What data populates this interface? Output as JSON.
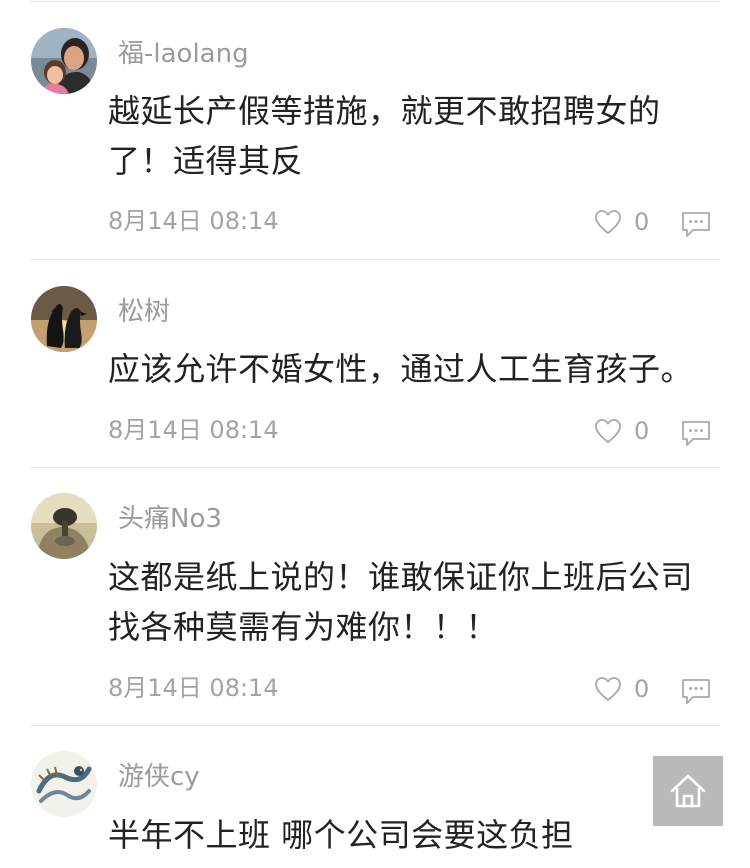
{
  "comments": [
    {
      "username": "福-laolang",
      "avatar": "parent-child-photo",
      "lines": [
        "越延长产假等措施，就更不敢招聘女的",
        "了！适得其反"
      ],
      "time": "8月14日 08:14",
      "likes": "0"
    },
    {
      "username": "松树",
      "avatar": "penguins-sunset-photo",
      "lines": [
        "应该允许不婚女性，通过人工生育孩子。"
      ],
      "time": "8月14日 08:14",
      "likes": "0"
    },
    {
      "username": "头痛No3",
      "avatar": "statue-photo",
      "lines": [
        "这都是纸上说的！谁敢保证你上班后公司",
        "找各种莫需有为难你！！！"
      ],
      "time": "8月14日 08:14",
      "likes": "0"
    },
    {
      "username": "游侠cy",
      "avatar": "dragon-drawing",
      "lines": [
        "半年不上班 哪个公司会要这负担"
      ]
    }
  ],
  "icons": {
    "like": "heart-outline-icon",
    "reply": "speech-bubble-icon",
    "home": "home-icon"
  },
  "colors": {
    "username": "#9b9b9b",
    "content": "#222222",
    "meta": "#a3a3a3",
    "home_button": "#b9b9b9"
  }
}
